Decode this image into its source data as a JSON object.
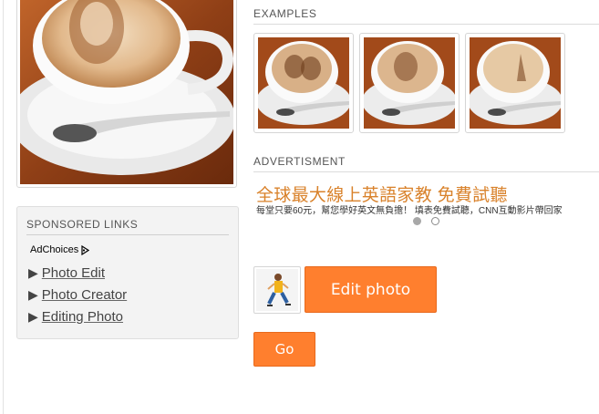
{
  "sponsored": {
    "title": "SPONSORED LINKS",
    "adchoices_label": "AdChoices",
    "adchoices_icon": "adchoices-icon",
    "links": [
      {
        "label": "Photo Edit",
        "icon": "triangle-right-icon"
      },
      {
        "label": "Photo Creator",
        "icon": "triangle-right-icon"
      },
      {
        "label": "Editing Photo",
        "icon": "triangle-right-icon"
      }
    ]
  },
  "examples": {
    "title": "EXAMPLES",
    "items": [
      "couple-latte-art",
      "portrait-latte-art",
      "eiffel-tower-latte-art"
    ]
  },
  "advertisement": {
    "title": "ADVERTISMENT",
    "headline": "全球最大線上英語家教 免費試聽",
    "subtext": "每堂只要60元，幫您學好英文無負擔！ 填表免費試聽，CNN互動影片帶回家",
    "slides": 2,
    "active_slide": 1
  },
  "actions": {
    "edit_label": "Edit photo",
    "go_label": "Go"
  },
  "colors": {
    "accent": "#ff7f2e",
    "ad_headline": "#d9822b",
    "panel_bg": "#f3f3f3"
  }
}
